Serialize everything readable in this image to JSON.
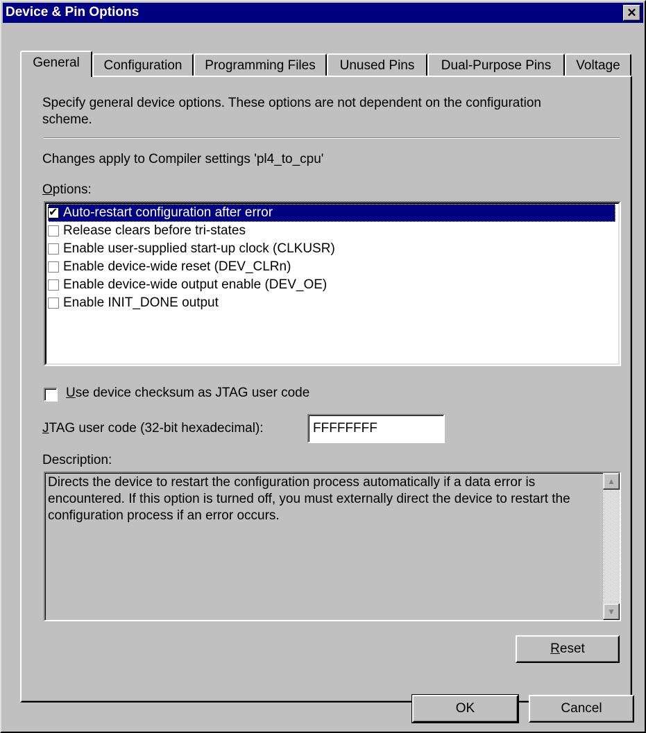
{
  "window": {
    "title": "Device & Pin Options",
    "close_label": "✕"
  },
  "tabs": [
    {
      "label": "General",
      "active": true
    },
    {
      "label": "Configuration"
    },
    {
      "label": "Programming Files"
    },
    {
      "label": "Unused Pins"
    },
    {
      "label": "Dual-Purpose Pins"
    },
    {
      "label": "Voltage"
    }
  ],
  "general": {
    "intro": "Specify general device options.  These options are not dependent on the configuration",
    "intro_line2": "scheme.",
    "changes_apply": "Changes apply to Compiler settings 'pl4_to_cpu'",
    "options_label_first": "O",
    "options_label_rest": "ptions:",
    "options": [
      {
        "label": "Auto-restart configuration after error",
        "checked": true,
        "selected": true
      },
      {
        "label": "Release clears before tri-states",
        "checked": false
      },
      {
        "label": "Enable user-supplied start-up clock (CLKUSR)",
        "checked": false
      },
      {
        "label": "Enable device-wide reset (DEV_CLRn)",
        "checked": false
      },
      {
        "label": "Enable device-wide output enable (DEV_OE)",
        "checked": false
      },
      {
        "label": "Enable INIT_DONE output",
        "checked": false
      }
    ],
    "checksum_first": "U",
    "checksum_rest": "se device checksum as JTAG user code",
    "checksum_checked": false,
    "jtag_label_first": "J",
    "jtag_label_rest": "TAG user code (32-bit hexadecimal):",
    "jtag_value": "FFFFFFFF",
    "description_label": "Description:",
    "description_text": "Directs the device to restart the configuration process automatically if a data error is encountered. If this option is turned off, you must externally direct the device to restart the configuration process if an error occurs.",
    "reset_first": "R",
    "reset_rest": "eset"
  },
  "footer": {
    "ok_label": "OK",
    "cancel_label": "Cancel"
  }
}
